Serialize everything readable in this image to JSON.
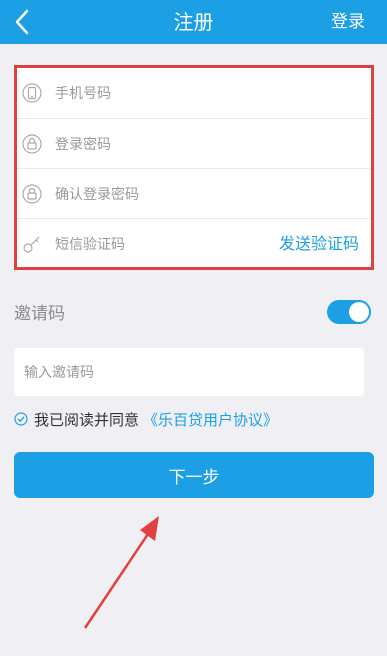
{
  "header": {
    "title": "注册",
    "login_label": "登录"
  },
  "form": {
    "phone_placeholder": "手机号码",
    "password_placeholder": "登录密码",
    "confirm_password_placeholder": "确认登录密码",
    "sms_code_placeholder": "短信验证码",
    "send_code_label": "发送验证码"
  },
  "invite": {
    "label": "邀请码",
    "toggle_on": true,
    "input_placeholder": "输入邀请码"
  },
  "agreement": {
    "text": "我已阅读并同意",
    "link": "《乐百贷用户协议》",
    "checked": true
  },
  "next_button": "下一步",
  "colors": {
    "brand": "#1d9fe6",
    "annotation": "#e04040",
    "background": "#efeff4"
  },
  "icons": [
    "back-icon",
    "phone-icon",
    "lock-icon",
    "key-icon",
    "checkbox-icon",
    "annotation-arrow"
  ]
}
